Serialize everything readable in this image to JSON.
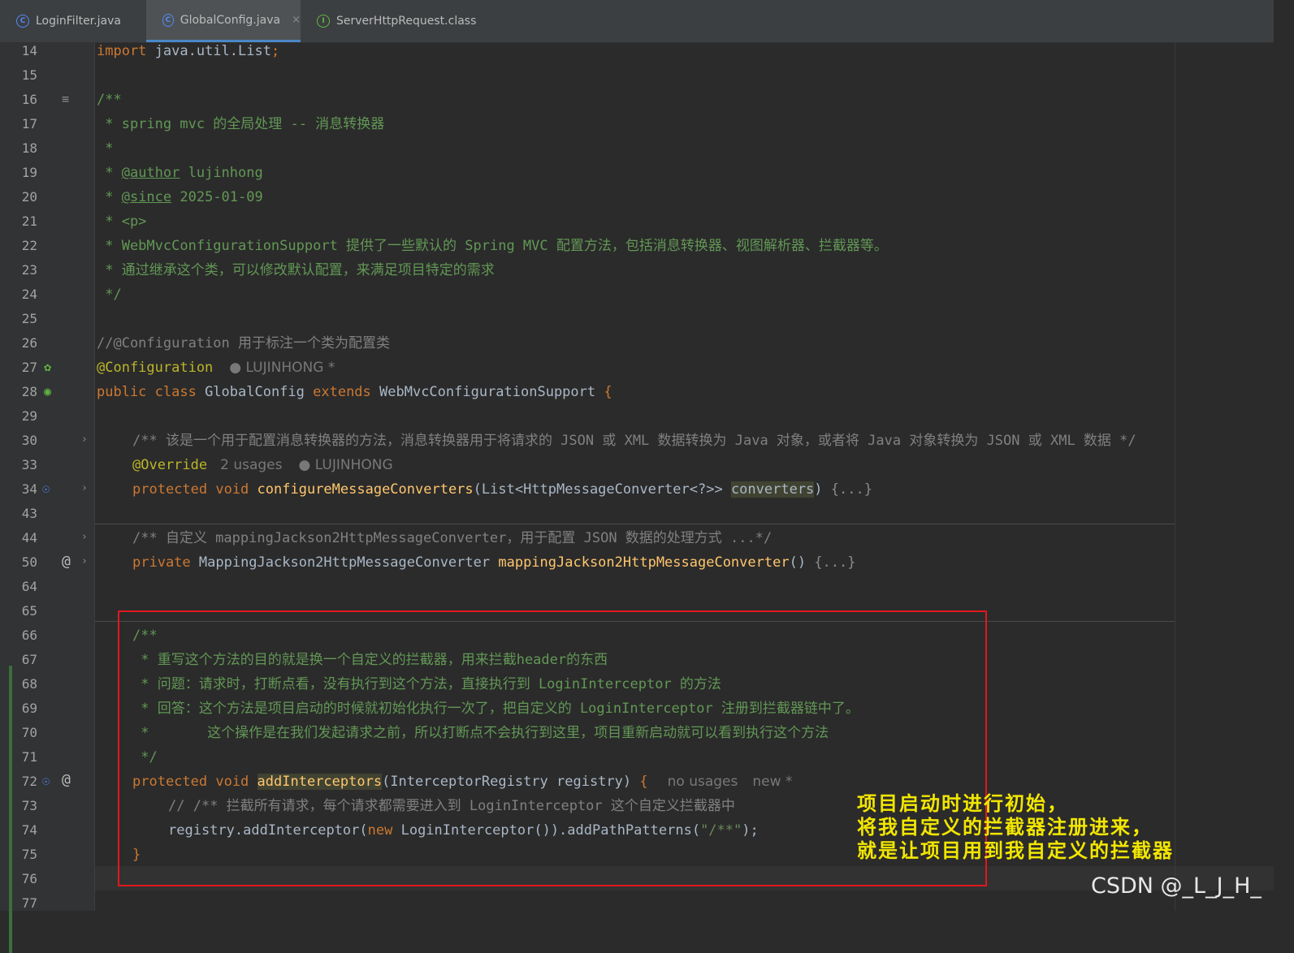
{
  "tabs": [
    {
      "label": "LoginFilter.java",
      "icon": "class-icon",
      "active": false
    },
    {
      "label": "GlobalConfig.java",
      "icon": "class-icon",
      "active": true,
      "close": "×"
    },
    {
      "label": "ServerHttpRequest.class",
      "icon": "interface-icon",
      "active": false
    }
  ],
  "line_numbers": [
    "14",
    "15",
    "16",
    "17",
    "18",
    "19",
    "20",
    "21",
    "22",
    "23",
    "24",
    "25",
    "26",
    "27",
    "28",
    "29",
    "30",
    "33",
    "34",
    "43",
    "44",
    "50",
    "64",
    "65",
    "66",
    "67",
    "68",
    "69",
    "70",
    "71",
    "72",
    "73",
    "74",
    "75",
    "76",
    "77"
  ],
  "code": {
    "l14": {
      "kw": "import",
      "rest": " java.util.List",
      "semi": ";"
    },
    "l16": "/**",
    "l17": " * spring mvc 的全局处理 -- 消息转换器",
    "l18": " *",
    "l19": {
      "pre": " * ",
      "tag": "@author",
      "post": " lujinhong"
    },
    "l20": {
      "pre": " * ",
      "tag": "@since",
      "post": " 2025-01-09"
    },
    "l21": " * <p>",
    "l22": " * WebMvcConfigurationSupport 提供了一些默认的 Spring MVC 配置方法，包括消息转换器、视图解析器、拦截器等。",
    "l23": " * 通过继承这个类，可以修改默认配置，来满足项目特定的需求",
    "l24": " */",
    "l26": "//@Configuration 用于标注一个类为配置类",
    "l27": {
      "ann": "@Configuration",
      "hint": "LUJINHONG *"
    },
    "l28": {
      "kw1": "public class",
      "name": " GlobalConfig ",
      "kw2": "extends",
      "rest": " WebMvcConfigurationSupport ",
      "brace": "{"
    },
    "l30": "/** 该是一个用于配置消息转换器的方法，消息转换器用于将请求的 JSON 或 XML 数据转换为 Java 对象，或者将 Java 对象转换为 JSON 或 XML 数据 */",
    "l33": {
      "ann": "@Override",
      "usages": "2 usages",
      "author": "LUJINHONG"
    },
    "l34": {
      "kw": "protected void",
      "fn": "configureMessageConverters",
      "p1": "(List<HttpMessageConverter<?>> ",
      "param": "converters",
      "p2": ") ",
      "fold": "{...}"
    },
    "l44": "/** 自定义 mappingJackson2HttpMessageConverter，用于配置 JSON 数据的处理方式 ...*/",
    "l50": {
      "kw": "private",
      "type": " MappingJackson2HttpMessageConverter ",
      "fn": "mappingJackson2HttpMessageConverter",
      "p": "() ",
      "fold": "{...}"
    },
    "l66": "/**",
    "l67": " * 重写这个方法的目的就是换一个自定义的拦截器，用来拦截header的东西",
    "l68": " * 问题：请求时，打断点看，没有执行到这个方法，直接执行到 LoginInterceptor 的方法",
    "l69": " * 回答：这个方法是项目启动的时候就初始化执行一次了，把自定义的 LoginInterceptor 注册到拦截器链中了。",
    "l70": " *       这个操作是在我们发起请求之前，所以打断点不会执行到这里，项目重新启动就可以看到执行这个方法",
    "l71": " */",
    "l72": {
      "kw": "protected void",
      "fn": "addInterceptors",
      "p": "(InterceptorRegistry registry) ",
      "brace": "{",
      "usages": "no usages",
      "new": "new *"
    },
    "l73": "// /** 拦截所有请求，每个请求都需要进入到 LoginInterceptor 这个自定义拦截器中",
    "l74": {
      "a": "registry.addInterceptor(",
      "kw": "new",
      "b": " LoginInterceptor()).addPathPatterns(",
      "str": "\"/**\"",
      "c": ");"
    },
    "l75": "}"
  },
  "annotation_note": [
    "项目启动时进行初始，",
    "将我自定义的拦截器注册进来，",
    "就是让项目用到我自定义的拦截器"
  ],
  "watermark": "CSDN @_L_J_H_",
  "colors": {
    "keyword": "#cc7832",
    "doc_comment": "#629755",
    "function": "#ffc66d",
    "annotation": "#bbb529",
    "highlight_box": "#e0181e",
    "note_text": "#f2e600"
  }
}
